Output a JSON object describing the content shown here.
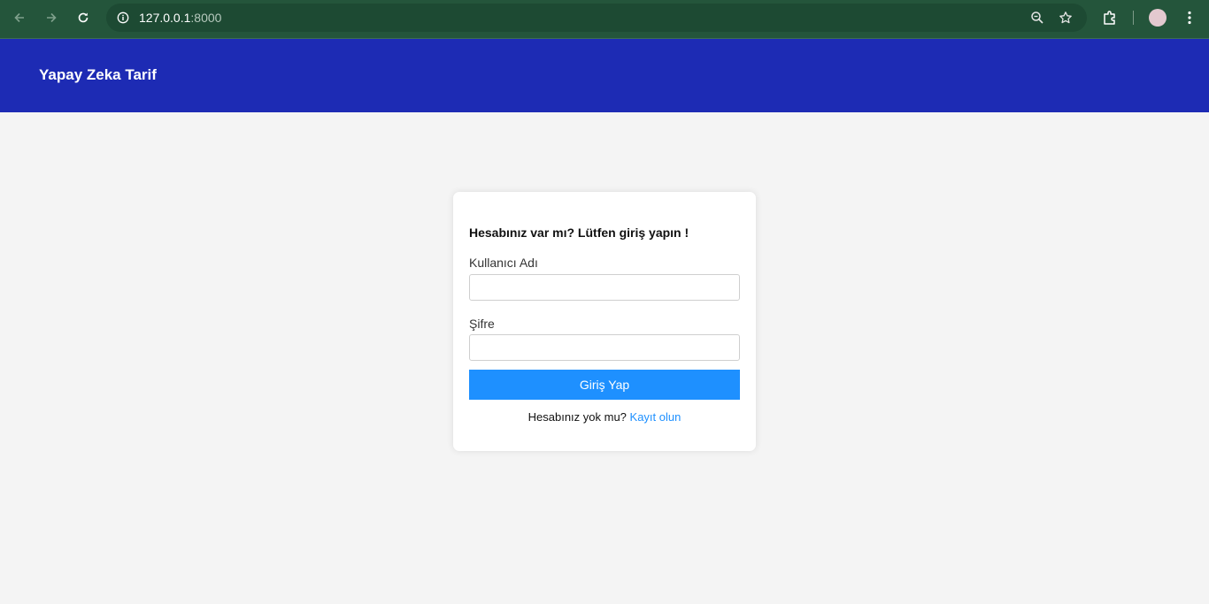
{
  "browser": {
    "url_host": "127.0.0.1",
    "url_port": ":8000",
    "icons": [
      "back-arrow-icon",
      "forward-arrow-icon",
      "reload-icon",
      "site-info-icon",
      "zoom-icon",
      "bookmark-star-icon",
      "extensions-icon",
      "profile-avatar",
      "kebab-menu-icon"
    ]
  },
  "header": {
    "brand": "Yapay Zeka Tarif",
    "background": "#1d2bb4"
  },
  "login": {
    "heading": "Hesabınız var mı? Lütfen giriş yapın !",
    "username_label": "Kullanıcı Adı",
    "username_value": "",
    "password_label": "Şifre",
    "password_value": "",
    "submit_label": "Giriş Yap",
    "no_account_text": "Hesabınız yok mu?",
    "register_link": "Kayıt olun",
    "accent": "#1e90ff"
  }
}
